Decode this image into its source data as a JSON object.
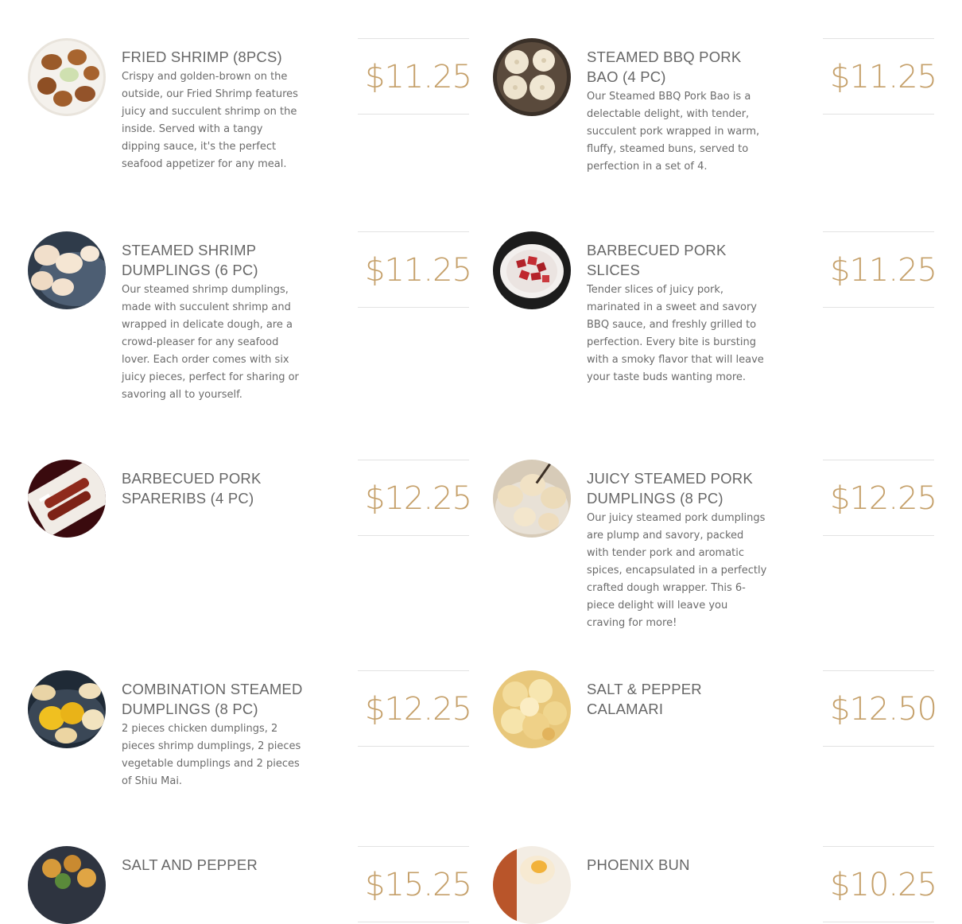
{
  "menu_items": [
    {
      "name": "FRIED SHRIMP (8PCS)",
      "description": "Crispy and golden-brown on the outside, our Fried Shrimp features juicy and succulent shrimp on the inside. Served with a tangy dipping sauce, it's the perfect seafood appetizer for any meal.",
      "price": "$11.25",
      "photo": "fried-shrimp-photo"
    },
    {
      "name": "STEAMED BBQ PORK BAO (4 PC)",
      "description": "Our Steamed BBQ Pork Bao is a delectable delight, with tender, succulent pork wrapped in warm, fluffy, steamed buns, served to perfection in a set of 4.",
      "price": "$11.25",
      "photo": "steamed-bao-photo"
    },
    {
      "name": "STEAMED SHRIMP DUMPLINGS (6 PC)",
      "description": "Our steamed shrimp dumplings, made with succulent shrimp and wrapped in delicate dough, are a crowd-pleaser for any seafood lover. Each order comes with six juicy pieces, perfect for sharing or savoring all to yourself.",
      "price": "$11.25",
      "photo": "shrimp-dumplings-photo"
    },
    {
      "name": "BARBECUED PORK SLICES",
      "description": "Tender slices of juicy pork, marinated in a sweet and savory BBQ sauce, and freshly grilled to perfection. Every bite is bursting with a smoky flavor that will leave your taste buds wanting more.",
      "price": "$11.25",
      "photo": "pork-slices-photo"
    },
    {
      "name": "BARBECUED PORK SPARERIBS (4 PC)",
      "description": "",
      "price": "$12.25",
      "photo": "spareribs-photo"
    },
    {
      "name": "JUICY STEAMED PORK DUMPLINGS (8 PC)",
      "description": "Our juicy steamed pork dumplings are plump and savory, packed with tender pork and aromatic spices, encapsulated in a perfectly crafted dough wrapper. This 6-piece delight will leave you craving for more!",
      "price": "$12.25",
      "photo": "pork-dumplings-photo"
    },
    {
      "name": "COMBINATION STEAMED DUMPLINGS (8 PC)",
      "description": "2 pieces chicken dumplings, 2 pieces shrimp dumplings, 2 pieces vegetable dumplings and 2 pieces of Shiu Mai.",
      "price": "$12.25",
      "photo": "combination-dumplings-photo"
    },
    {
      "name": "SALT & PEPPER CALAMARI",
      "description": "",
      "price": "$12.50",
      "photo": "calamari-photo"
    },
    {
      "name": "SALT AND PEPPER",
      "description": "",
      "price": "$15.25",
      "photo": "salt-pepper-photo"
    },
    {
      "name": "PHOENIX BUN",
      "description": "",
      "price": "$10.25",
      "photo": "phoenix-bun-photo"
    }
  ]
}
